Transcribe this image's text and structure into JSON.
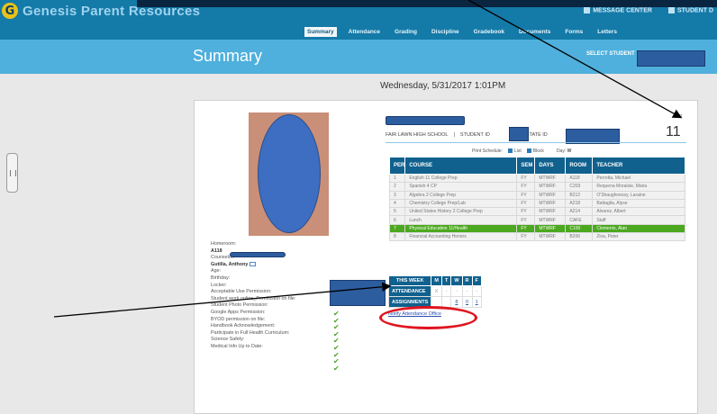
{
  "app": {
    "brand_icon": "G",
    "brand": "Genesis Parent Resources",
    "top_links": [
      "MESSAGE CENTER",
      "STUDENT D"
    ]
  },
  "nav": {
    "tabs": [
      "Summary",
      "Attendance",
      "Grading",
      "Discipline",
      "Gradebook",
      "Documents",
      "Forms",
      "Letters"
    ],
    "active_tab": "Summary"
  },
  "header": {
    "title": "Summary",
    "select_student": "SELECT STUDENT"
  },
  "date_time": "Wednesday, 5/31/2017 1:01PM",
  "student": {
    "homeroom_label": "Homeroom:",
    "homeroom": "A118",
    "counselor_label": "Counselor:",
    "counselor": "Gutilla, Anthony",
    "age_label": "Age:",
    "birthday_label": "Birthday:",
    "locker_label": "Locker:",
    "permissions": [
      "Acceptable Use Permission:",
      "Student work online_Permission on file:",
      "Student Photo Permission:",
      "Google Apps Permission:",
      "BYOD permission on file:",
      "Handbook Acknowledgement:",
      "Participate in Full Health Curriculum:",
      "Science Safety:",
      "Medical Info Up to Date:"
    ],
    "check_glyph": "✔"
  },
  "school": {
    "name": "FAIR LAWN HIGH SCHOOL",
    "separator": "|",
    "student_id_label": "STUDENT ID",
    "state_id_label": "STATE ID",
    "grade_label": "GR",
    "grade": "11"
  },
  "print_schedule": {
    "label": "Print Schedule:",
    "list": "List",
    "block": "Block",
    "day_label": "Day:",
    "day": "W"
  },
  "schedule": {
    "headers": [
      "PER",
      "COURSE",
      "SEM",
      "DAYS",
      "ROOM",
      "TEACHER"
    ],
    "rows": [
      [
        "1",
        "English 11 College Prep",
        "FY",
        "MTWRF",
        "A118",
        "Perrotta, Michael"
      ],
      [
        "2",
        "Spanish 4 CP",
        "FY",
        "MTWRF",
        "C203",
        "Requena Moraisie, Maria"
      ],
      [
        "3",
        "Algebra 2 College Prep",
        "FY",
        "MTWRF",
        "B212",
        "O'Shaughnessy, Laraine"
      ],
      [
        "4",
        "Chemistry College Prep/Lab",
        "FY",
        "MTWRF",
        "A218",
        "Battaglia, Alyse"
      ],
      [
        "5",
        "United States History 2 College Prep",
        "FY",
        "MTWRF",
        "A214",
        "Alvarez, Albert"
      ],
      [
        "6",
        "Lunch",
        "FY",
        "MTWRF",
        "CAFE",
        "Staff"
      ],
      [
        "7",
        "Physical Education 11/Health",
        "FY",
        "MTWRF",
        "C100",
        "Clements, Alan"
      ],
      [
        "8",
        "Financial Accounting Honors",
        "FY",
        "MTWRF",
        "B206",
        "Ziva, Peter"
      ]
    ],
    "highlight_row": 6
  },
  "this_week": {
    "headers": [
      "THIS WEEK",
      "M",
      "T",
      "W",
      "R",
      "F"
    ],
    "attendance_label": "ATTENDANCE",
    "attendance": [
      "X",
      "-",
      "-",
      "-",
      "-"
    ],
    "assignments_label": "ASSIGNMENTS",
    "assignments": [
      "",
      "",
      "8",
      "0",
      "1"
    ]
  },
  "notify_link": "Notify Attendance Office",
  "colors": {
    "topbar": "#147aa8",
    "subheader": "#4fb0dd",
    "table_header": "#10618e",
    "highlight": "#4ca81e",
    "redact": "#2c5d9f",
    "ring": "#e0141f"
  }
}
